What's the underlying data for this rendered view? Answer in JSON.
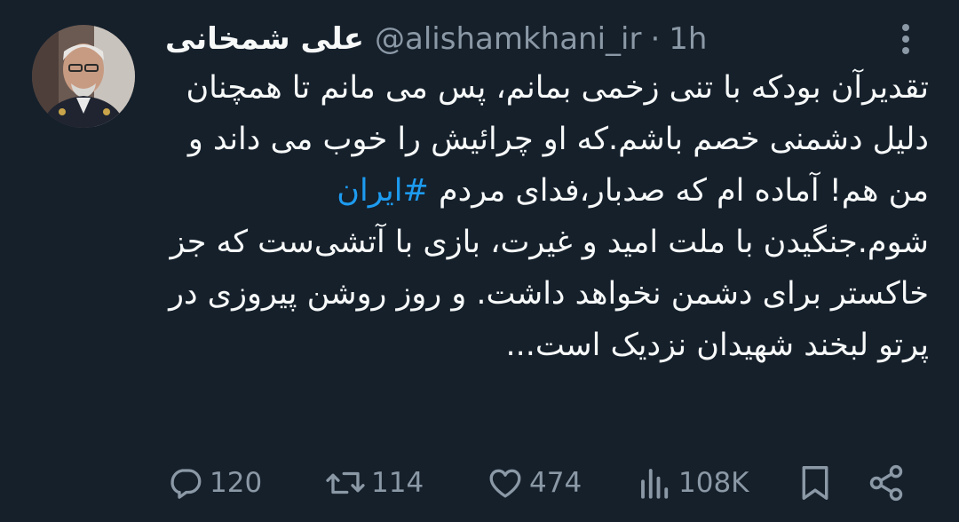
{
  "author": {
    "display_name": "علی شمخانی",
    "handle": "@alishamkhani_ir",
    "separator": "·",
    "time": "1h"
  },
  "tweet": {
    "text_before_hashtag": "تقدیرآن بودکه با تنی زخمی بمانم، پس می مانم تا همچنان دلیل دشمنی خصم باشم.که او چرائیش را خوب می داند و من هم! آماده ام که صدبار،فدای مردم ",
    "hashtag": "#ایران",
    "text_after_hashtag": " شوم.جنگیدن با ملت امید و غیرت، بازی با آتشی‌ست که جز خاکستر برای دشمن نخواهد داشت. و روز روشن پیروزی در پرتو لبخند شهیدان نزدیک است..."
  },
  "metrics": {
    "replies": "120",
    "retweets": "114",
    "likes": "474",
    "views": "108K"
  },
  "icons": {
    "reply": "reply-icon",
    "retweet": "retweet-icon",
    "like": "heart-icon",
    "views": "views-icon",
    "bookmark": "bookmark-icon",
    "share": "share-icon",
    "more": "more-icon"
  },
  "colors": {
    "background": "#15202b",
    "text": "#f7f9f9",
    "muted": "#8b98a5",
    "hashtag": "#1d9bf0"
  }
}
